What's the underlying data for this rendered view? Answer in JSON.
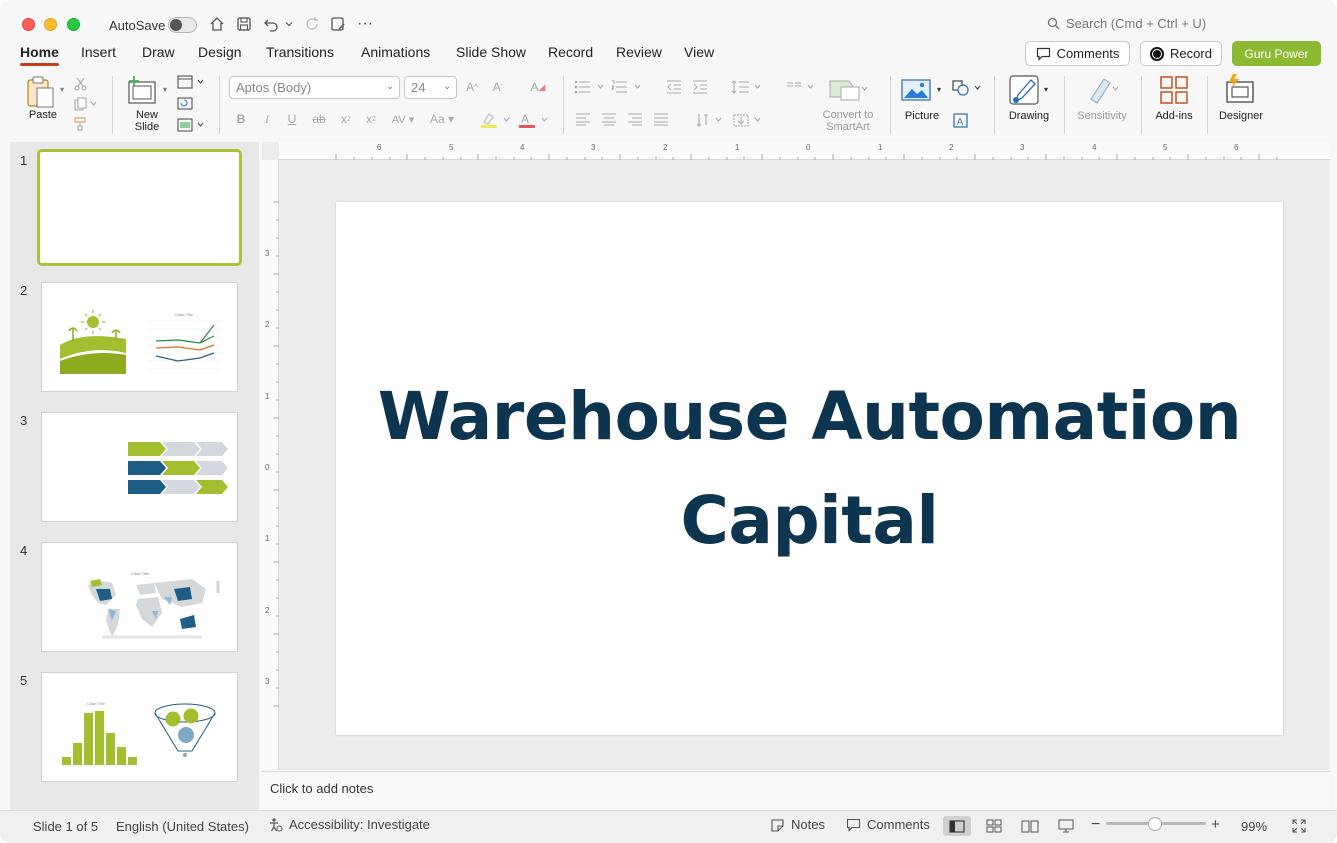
{
  "titlebar": {
    "autosave_label": "AutoSave",
    "search_placeholder": "Search (Cmd + Ctrl + U)"
  },
  "tabs": [
    {
      "label": "Home"
    },
    {
      "label": "Insert"
    },
    {
      "label": "Draw"
    },
    {
      "label": "Design"
    },
    {
      "label": "Transitions"
    },
    {
      "label": "Animations"
    },
    {
      "label": "Slide Show"
    },
    {
      "label": "Record"
    },
    {
      "label": "Review"
    },
    {
      "label": "View"
    }
  ],
  "actions": {
    "comments": "Comments",
    "record": "Record",
    "guru": "Guru Power"
  },
  "ribbon": {
    "paste": "Paste",
    "new_slide_1": "New",
    "new_slide_2": "Slide",
    "font_name": "Aptos (Body)",
    "font_size": "24",
    "convert_1": "Convert to",
    "convert_2": "SmartArt",
    "picture": "Picture",
    "drawing": "Drawing",
    "sensitivity": "Sensitivity",
    "addins": "Add-ins",
    "designer": "Designer"
  },
  "thumbnails": {
    "numbers": [
      "1",
      "2",
      "3",
      "4",
      "5"
    ],
    "chart_title": "Chart Title"
  },
  "slide": {
    "title_line1": "Warehouse Automation",
    "title_line2": "Capital"
  },
  "notes": {
    "placeholder": "Click to add notes"
  },
  "ruler": {
    "h_labels": [
      "6",
      "5",
      "4",
      "3",
      "2",
      "1",
      "0",
      "1",
      "2",
      "3",
      "4",
      "5",
      "6"
    ],
    "v_labels": [
      "3",
      "2",
      "1",
      "0",
      "1",
      "2",
      "3"
    ]
  },
  "statusbar": {
    "slide_count": "Slide 1 of 5",
    "language": "English (United States)",
    "accessibility": "Accessibility: Investigate",
    "notes": "Notes",
    "comments": "Comments",
    "zoom": "99%"
  },
  "colors": {
    "accent_tab": "#c43e1c",
    "guru": "#8cb832",
    "title": "#0e3550",
    "thumb_selected": "#a8c23a"
  }
}
